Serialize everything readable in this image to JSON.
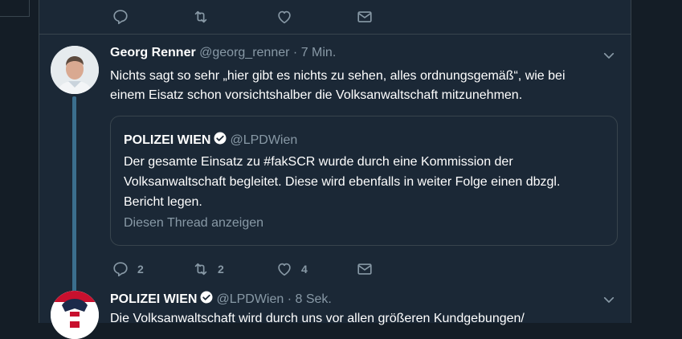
{
  "actions_top": {
    "reply_count": "",
    "retweet_count": "",
    "like_count": ""
  },
  "tweet1": {
    "name": "Georg Renner",
    "handle": "@georg_renner",
    "dot": "·",
    "time": "7 Min.",
    "text_line1": "Nichts sagt so sehr „hier gibt es nichts zu sehen, alles ordnungsgemäß“, wie bei",
    "text_line2": "einem Eisatz schon vorsichtshalber die Volksanwaltschaft mitzunehmen.",
    "quote": {
      "name": "POLIZEI WIEN",
      "handle": "@LPDWien",
      "text_line1": "Der gesamte Einsatz zu #fakSCR wurde durch eine Kommission der",
      "text_line2": "Volksanwaltschaft begleitet. Diese wird ebenfalls in weiter Folge einen dbzgl.",
      "text_line3": "Bericht legen.",
      "show_thread": "Diesen Thread anzeigen"
    },
    "actions": {
      "reply_count": "2",
      "retweet_count": "2",
      "like_count": "4"
    }
  },
  "tweet2": {
    "name": "POLIZEI WIEN",
    "handle": "@LPDWien",
    "dot": "·",
    "time": "8 Sek.",
    "text_line1": "Die Volksanwaltschaft wird durch uns vor allen größeren Kundgebungen/"
  },
  "colors": {
    "background": "#141d26",
    "card": "#1b2836",
    "accent": "#1da1f2",
    "thread": "#3b6e8d"
  }
}
